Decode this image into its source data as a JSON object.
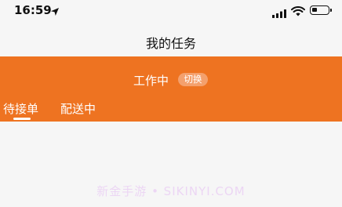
{
  "status_bar": {
    "time": "16:59",
    "icons": [
      "location-arrow-icon",
      "signal-icon",
      "wifi-icon",
      "battery-icon"
    ],
    "battery_level": 0.35
  },
  "header": {
    "title": "我的任务"
  },
  "work": {
    "status_text": "工作中",
    "switch_label": "切换",
    "accent_color": "#ee7321"
  },
  "tabs": [
    {
      "label": "待接单",
      "active": true
    },
    {
      "label": "配送中",
      "active": false
    }
  ],
  "watermark": "新金手游 • SIKINYI.COM"
}
